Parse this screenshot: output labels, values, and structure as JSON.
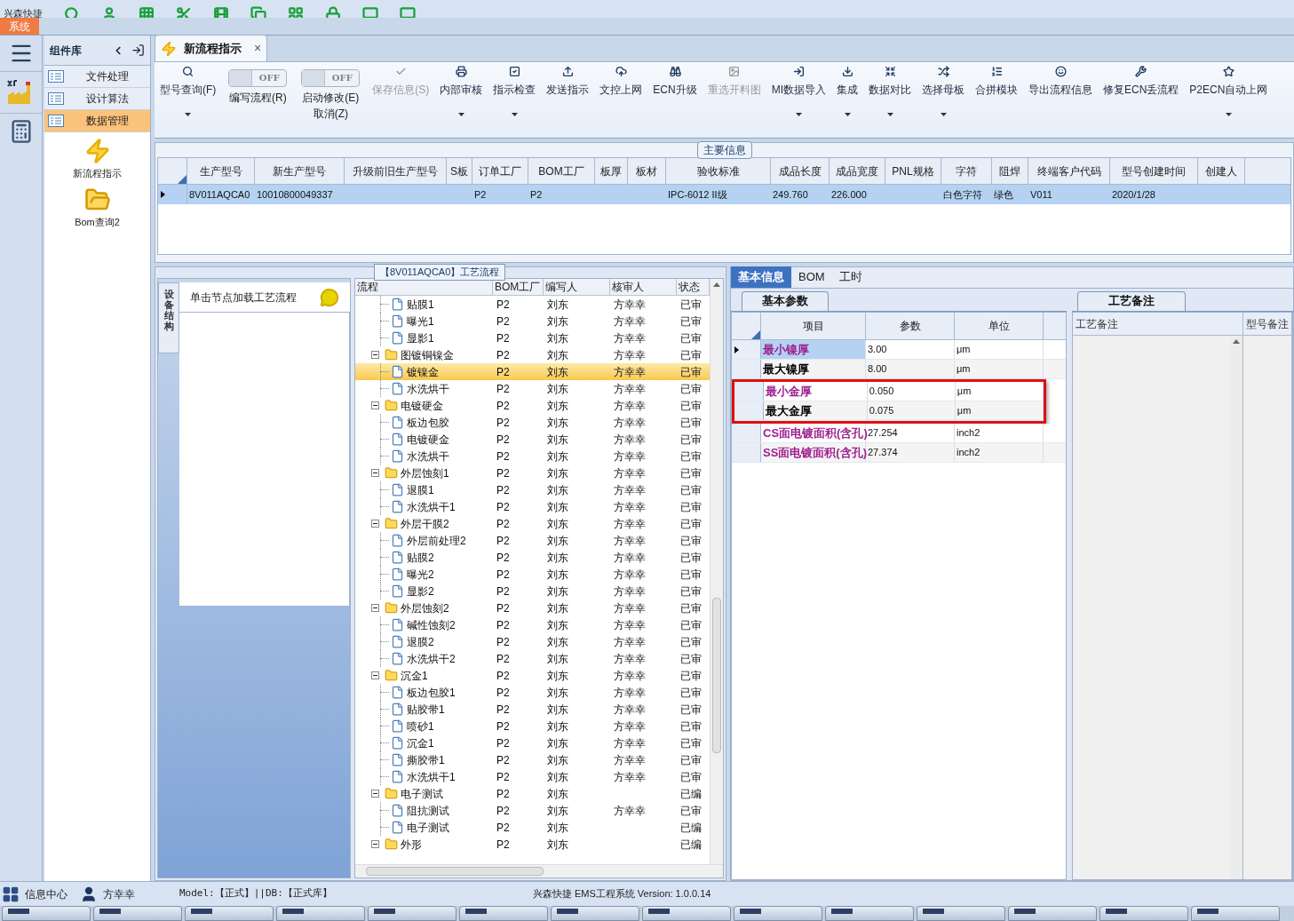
{
  "quick_bar": {
    "title": "兴森快捷"
  },
  "ribbon_tabs": [
    {
      "label": "系统",
      "selected": true
    }
  ],
  "component_library": {
    "title": "组件库",
    "items": [
      {
        "label": "文件处理",
        "selected": false
      },
      {
        "label": "设计算法",
        "selected": false
      },
      {
        "label": "数据管理",
        "selected": true
      }
    ],
    "tools": [
      {
        "label": "新流程指示",
        "kind": "flash"
      },
      {
        "label": "Bom查询2",
        "kind": "folder"
      }
    ]
  },
  "document_tab": {
    "label": "新流程指示",
    "selected": true,
    "close": "×"
  },
  "toolbar": [
    {
      "kind": "button",
      "label": "型号查询(F)",
      "dropdown": true,
      "disabled": false
    },
    {
      "kind": "toggle",
      "toggle_text": "OFF",
      "on": false,
      "label": "编写流程(R)"
    },
    {
      "kind": "toggle",
      "toggle_text": "OFF",
      "on": false,
      "label": "启动修改(E)",
      "label_2": "取消(Z)"
    },
    {
      "kind": "button",
      "label": "保存信息(S)",
      "dropdown": false,
      "disabled": true
    },
    {
      "kind": "button",
      "label": "内部审核",
      "dropdown": true,
      "disabled": false
    },
    {
      "kind": "button",
      "label": "指示检查",
      "dropdown": true,
      "disabled": false
    },
    {
      "kind": "button",
      "label": "发送指示",
      "dropdown": false,
      "disabled": false
    },
    {
      "kind": "button",
      "label": "文控上网",
      "dropdown": false,
      "disabled": false
    },
    {
      "kind": "button",
      "label": "ECN升级",
      "dropdown": false,
      "disabled": false
    },
    {
      "kind": "button",
      "label": "重选开料图",
      "dropdown": false,
      "disabled": true
    },
    {
      "kind": "button",
      "label": "MI数据导入",
      "dropdown": true,
      "disabled": false
    },
    {
      "kind": "button",
      "label": "集成",
      "dropdown": true,
      "disabled": false
    },
    {
      "kind": "button",
      "label": "数据对比",
      "dropdown": true,
      "disabled": false
    },
    {
      "kind": "button",
      "label": "选择母板",
      "dropdown": true,
      "disabled": false
    },
    {
      "kind": "button",
      "label": "合拼模块",
      "dropdown": false,
      "disabled": false
    },
    {
      "kind": "button",
      "label": "导出流程信息",
      "dropdown": false,
      "disabled": false
    },
    {
      "kind": "button",
      "label": "修复ECN丢流程",
      "dropdown": false,
      "disabled": false
    },
    {
      "kind": "button",
      "label": "P2ECN自动上网",
      "dropdown": true,
      "disabled": false
    }
  ],
  "main_info": {
    "title": "主要信息",
    "columns": [
      "生产型号",
      "新生产型号",
      "升级前旧生产型号",
      "S板",
      "订单工厂",
      "BOM工厂",
      "板厚",
      "板材",
      "验收标准",
      "成品长度",
      "成品宽度",
      "PNL规格",
      "字符",
      "阻焊",
      "终端客户代码",
      "型号创建时间",
      "创建人"
    ],
    "rows": [
      {
        "selected": true,
        "cells": [
          "8V011AQCA0",
          "10010800049337",
          null,
          null,
          "P2",
          "P2",
          null,
          null,
          "IPC-6012 II级",
          "249.760",
          "226.000",
          null,
          "白色字符",
          "绿色",
          "V011",
          "2020/1/28",
          null
        ]
      }
    ]
  },
  "side_panel": {
    "vertical_tab": "设备结构",
    "hint": "单击节点加载工艺流程"
  },
  "process_flow": {
    "title": "【8V011AQCA0】工艺流程",
    "columns": [
      "流程",
      "BOM工厂",
      "编写人",
      "核审人",
      "状态"
    ],
    "rows": [
      {
        "kind": "step",
        "label": "贴膜1",
        "bom": "P2",
        "writer": "刘东",
        "reviewer": "方幸幸",
        "status": "已审",
        "selected": false
      },
      {
        "kind": "step",
        "label": "曝光1",
        "bom": "P2",
        "writer": "刘东",
        "reviewer": "方幸幸",
        "status": "已审",
        "selected": false
      },
      {
        "kind": "step",
        "label": "显影1",
        "bom": "P2",
        "writer": "刘东",
        "reviewer": "方幸幸",
        "status": "已审",
        "selected": false
      },
      {
        "kind": "group",
        "label": "图镀铜镍金",
        "bom": "P2",
        "writer": "刘东",
        "reviewer": "方幸幸",
        "status": "已审",
        "selected": false,
        "expanded": true,
        "children": [
          {
            "kind": "step",
            "label": "镀镍金",
            "bom": "P2",
            "writer": "刘东",
            "reviewer": "方幸幸",
            "status": "已审",
            "selected": true
          },
          {
            "kind": "step",
            "label": "水洗烘干",
            "bom": "P2",
            "writer": "刘东",
            "reviewer": "方幸幸",
            "status": "已审",
            "selected": false
          }
        ]
      },
      {
        "kind": "group",
        "label": "电镀硬金",
        "bom": "P2",
        "writer": "刘东",
        "reviewer": "方幸幸",
        "status": "已审",
        "selected": false,
        "expanded": true,
        "children": [
          {
            "kind": "step",
            "label": "板边包胶",
            "bom": "P2",
            "writer": "刘东",
            "reviewer": "方幸幸",
            "status": "已审",
            "selected": false
          },
          {
            "kind": "step",
            "label": "电镀硬金",
            "bom": "P2",
            "writer": "刘东",
            "reviewer": "方幸幸",
            "status": "已审",
            "selected": false
          },
          {
            "kind": "step",
            "label": "水洗烘干",
            "bom": "P2",
            "writer": "刘东",
            "reviewer": "方幸幸",
            "status": "已审",
            "selected": false
          }
        ]
      },
      {
        "kind": "group",
        "label": "外层蚀刻1",
        "bom": "P2",
        "writer": "刘东",
        "reviewer": "方幸幸",
        "status": "已审",
        "selected": false,
        "expanded": true,
        "children": [
          {
            "kind": "step",
            "label": "退膜1",
            "bom": "P2",
            "writer": "刘东",
            "reviewer": "方幸幸",
            "status": "已审",
            "selected": false
          },
          {
            "kind": "step",
            "label": "水洗烘干1",
            "bom": "P2",
            "writer": "刘东",
            "reviewer": "方幸幸",
            "status": "已审",
            "selected": false
          }
        ]
      },
      {
        "kind": "group",
        "label": "外层干膜2",
        "bom": "P2",
        "writer": "刘东",
        "reviewer": "方幸幸",
        "status": "已审",
        "selected": false,
        "expanded": true,
        "children": [
          {
            "kind": "step",
            "label": "外层前处理2",
            "bom": "P2",
            "writer": "刘东",
            "reviewer": "方幸幸",
            "status": "已审",
            "selected": false
          },
          {
            "kind": "step",
            "label": "贴膜2",
            "bom": "P2",
            "writer": "刘东",
            "reviewer": "方幸幸",
            "status": "已审",
            "selected": false
          },
          {
            "kind": "step",
            "label": "曝光2",
            "bom": "P2",
            "writer": "刘东",
            "reviewer": "方幸幸",
            "status": "已审",
            "selected": false
          },
          {
            "kind": "step",
            "label": "显影2",
            "bom": "P2",
            "writer": "刘东",
            "reviewer": "方幸幸",
            "status": "已审",
            "selected": false
          }
        ]
      },
      {
        "kind": "group",
        "label": "外层蚀刻2",
        "bom": "P2",
        "writer": "刘东",
        "reviewer": "方幸幸",
        "status": "已审",
        "selected": false,
        "expanded": true,
        "children": [
          {
            "kind": "step",
            "label": "碱性蚀刻2",
            "bom": "P2",
            "writer": "刘东",
            "reviewer": "方幸幸",
            "status": "已审",
            "selected": false
          },
          {
            "kind": "step",
            "label": "退膜2",
            "bom": "P2",
            "writer": "刘东",
            "reviewer": "方幸幸",
            "status": "已审",
            "selected": false
          },
          {
            "kind": "step",
            "label": "水洗烘干2",
            "bom": "P2",
            "writer": "刘东",
            "reviewer": "方幸幸",
            "status": "已审",
            "selected": false
          }
        ]
      },
      {
        "kind": "group",
        "label": "沉金1",
        "bom": "P2",
        "writer": "刘东",
        "reviewer": "方幸幸",
        "status": "已审",
        "selected": false,
        "expanded": true,
        "children": [
          {
            "kind": "step",
            "label": "板边包胶1",
            "bom": "P2",
            "writer": "刘东",
            "reviewer": "方幸幸",
            "status": "已审",
            "selected": false
          },
          {
            "kind": "step",
            "label": "贴胶带1",
            "bom": "P2",
            "writer": "刘东",
            "reviewer": "方幸幸",
            "status": "已审",
            "selected": false
          },
          {
            "kind": "step",
            "label": "喷砂1",
            "bom": "P2",
            "writer": "刘东",
            "reviewer": "方幸幸",
            "status": "已审",
            "selected": false
          },
          {
            "kind": "step",
            "label": "沉金1",
            "bom": "P2",
            "writer": "刘东",
            "reviewer": "方幸幸",
            "status": "已审",
            "selected": false
          },
          {
            "kind": "step",
            "label": "撕胶带1",
            "bom": "P2",
            "writer": "刘东",
            "reviewer": "方幸幸",
            "status": "已审",
            "selected": false
          },
          {
            "kind": "step",
            "label": "水洗烘干1",
            "bom": "P2",
            "writer": "刘东",
            "reviewer": "方幸幸",
            "status": "已审",
            "selected": false
          }
        ]
      },
      {
        "kind": "group",
        "label": "电子测试",
        "bom": "P2",
        "writer": "刘东",
        "status": "已编",
        "selected": false,
        "expanded": true,
        "children": [
          {
            "kind": "step",
            "label": "阻抗测试",
            "bom": "P2",
            "writer": "刘东",
            "reviewer": "方幸幸",
            "status": "已审",
            "selected": false
          },
          {
            "kind": "step",
            "label": "电子测试",
            "bom": "P2",
            "writer": "刘东",
            "status": "已编",
            "selected": false
          }
        ]
      },
      {
        "kind": "group",
        "label": "外形",
        "bom": "P2",
        "writer": "刘东",
        "status": "已编",
        "selected": false,
        "expanded": true
      }
    ]
  },
  "detail_tabs": [
    {
      "label": "基本信息",
      "selected": true
    },
    {
      "label": "BOM",
      "selected": false
    },
    {
      "label": "工时",
      "selected": false
    }
  ],
  "basic_params": {
    "tab": "基本参数",
    "columns": [
      "项目",
      "参数",
      "单位"
    ],
    "rows": [
      {
        "name": "最小镍厚",
        "value": "3.00",
        "unit": "μm",
        "color": "#a0208f",
        "selected": true,
        "framed": false
      },
      {
        "name": "最大镍厚",
        "value": "8.00",
        "unit": "μm",
        "color": "#000000",
        "selected": false,
        "framed": false
      },
      {
        "name": "最小金厚",
        "value": "0.050",
        "unit": "μm",
        "color": "#a0208f",
        "selected": false,
        "framed": true
      },
      {
        "name": "最大金厚",
        "value": "0.075",
        "unit": "μm",
        "color": "#000000",
        "selected": false,
        "framed": true
      },
      {
        "name": "CS面电镀面积(含孔)",
        "value": "27.254",
        "unit": "inch2",
        "color": "#a0208f",
        "selected": false,
        "framed": false
      },
      {
        "name": "SS面电镀面积(含孔)",
        "value": "27.374",
        "unit": "inch2",
        "color": "#a0208f",
        "selected": false,
        "framed": false
      }
    ]
  },
  "remarks": {
    "tab": "工艺备注",
    "columns": [
      "工艺备注",
      "型号备注"
    ]
  },
  "status_bar": {
    "info_center": "信息中心",
    "user": "方幸幸",
    "model": "Model:【正式】||DB:【正式库】",
    "version": "兴森快捷 EMS工程系统 Version: 1.0.0.14"
  }
}
